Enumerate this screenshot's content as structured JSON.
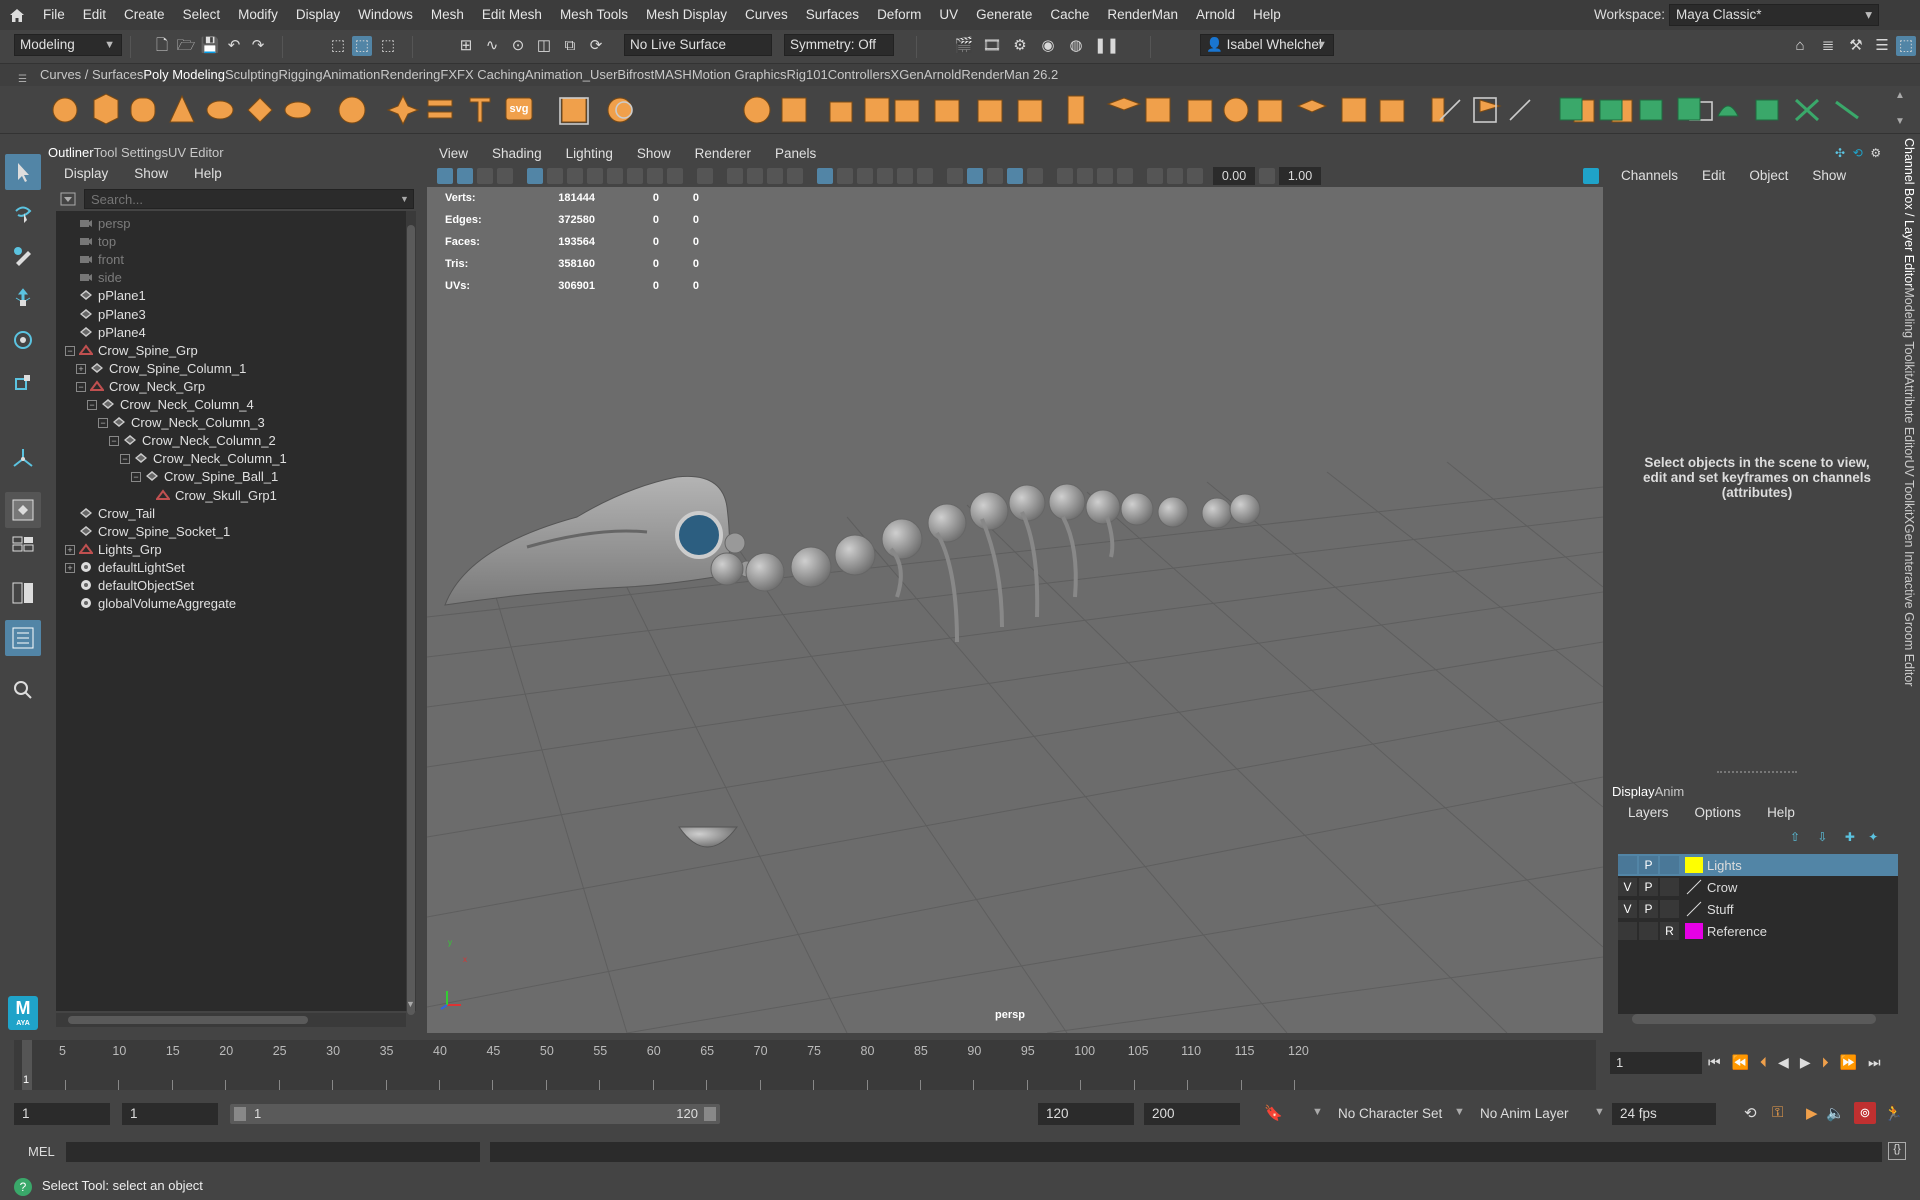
{
  "menubar": {
    "items": [
      "File",
      "Edit",
      "Create",
      "Select",
      "Modify",
      "Display",
      "Windows",
      "Mesh",
      "Edit Mesh",
      "Mesh Tools",
      "Mesh Display",
      "Curves",
      "Surfaces",
      "Deform",
      "UV",
      "Generate",
      "Cache",
      "RenderMan",
      "Arnold",
      "Help"
    ],
    "workspace_label": "Workspace:",
    "workspace_value": "Maya Classic*"
  },
  "statusline": {
    "mode": "Modeling",
    "live_surface": "No Live Surface",
    "symmetry": "Symmetry: Off",
    "user": "Isabel Whelchel"
  },
  "shelf": {
    "tabs": [
      "Curves / Surfaces",
      "Poly Modeling",
      "Sculpting",
      "Rigging",
      "Animation",
      "Rendering",
      "FX",
      "FX Caching",
      "Animation_User",
      "Bifrost",
      "MASH",
      "Motion Graphics",
      "Rig101",
      "Controllers",
      "XGen",
      "Arnold",
      "RenderMan 26.2"
    ],
    "active_tab": "Poly Modeling",
    "svg_label": "svg"
  },
  "outliner": {
    "tabs": [
      "Outliner",
      "Tool Settings",
      "UV Editor"
    ],
    "menu": [
      "Display",
      "Show",
      "Help"
    ],
    "search_placeholder": "Search...",
    "nodes": [
      {
        "label": "persp",
        "type": "camera"
      },
      {
        "label": "top",
        "type": "camera"
      },
      {
        "label": "front",
        "type": "camera"
      },
      {
        "label": "side",
        "type": "camera"
      },
      {
        "label": "pPlane1",
        "type": "mesh"
      },
      {
        "label": "pPlane3",
        "type": "mesh"
      },
      {
        "label": "pPlane4",
        "type": "mesh"
      },
      {
        "label": "Crow_Spine_Grp",
        "type": "group"
      },
      {
        "label": "Crow_Spine_Column_1",
        "type": "mesh"
      },
      {
        "label": "Crow_Neck_Grp",
        "type": "group"
      },
      {
        "label": "Crow_Neck_Column_4",
        "type": "mesh"
      },
      {
        "label": "Crow_Neck_Column_3",
        "type": "mesh"
      },
      {
        "label": "Crow_Neck_Column_2",
        "type": "mesh"
      },
      {
        "label": "Crow_Neck_Column_1",
        "type": "mesh"
      },
      {
        "label": "Crow_Spine_Ball_1",
        "type": "mesh"
      },
      {
        "label": "Crow_Skull_Grp1",
        "type": "group"
      },
      {
        "label": "Crow_Tail",
        "type": "mesh"
      },
      {
        "label": "Crow_Spine_Socket_1",
        "type": "mesh"
      },
      {
        "label": "Lights_Grp",
        "type": "group"
      },
      {
        "label": "defaultLightSet",
        "type": "set"
      },
      {
        "label": "defaultObjectSet",
        "type": "set"
      },
      {
        "label": "globalVolumeAggregate",
        "type": "volume"
      }
    ]
  },
  "viewport": {
    "menu": [
      "View",
      "Shading",
      "Lighting",
      "Show",
      "Renderer",
      "Panels"
    ],
    "field_a": "0.00",
    "field_b": "1.00",
    "hud": [
      {
        "label": "Verts:",
        "a": "181444",
        "b": "0",
        "c": "0"
      },
      {
        "label": "Edges:",
        "a": "372580",
        "b": "0",
        "c": "0"
      },
      {
        "label": "Faces:",
        "a": "193564",
        "b": "0",
        "c": "0"
      },
      {
        "label": "Tris:",
        "a": "358160",
        "b": "0",
        "c": "0"
      },
      {
        "label": "UVs:",
        "a": "306901",
        "b": "0",
        "c": "0"
      }
    ],
    "camera_label": "persp",
    "axis_x": "x",
    "axis_y": "y"
  },
  "channelbox": {
    "menu": [
      "Channels",
      "Edit",
      "Object",
      "Show"
    ],
    "hint": "Select objects in the scene to view, edit and set keyframes on channels (attributes)"
  },
  "side_tabs": {
    "items": [
      "Channel Box / Layer Editor",
      "Modeling Toolkit",
      "Attribute Editor",
      "UV Toolkit",
      "XGen Interactive Groom Editor"
    ]
  },
  "layer_editor": {
    "tabs": [
      "Display",
      "Anim"
    ],
    "menu": [
      "Layers",
      "Options",
      "Help"
    ],
    "layers": [
      {
        "v": "",
        "p": "P",
        "r": "",
        "name": "Lights",
        "color": "#ffff00",
        "selected": true
      },
      {
        "v": "V",
        "p": "P",
        "r": "",
        "name": "Crow",
        "color": "",
        "selected": false
      },
      {
        "v": "V",
        "p": "P",
        "r": "",
        "name": "Stuff",
        "color": "",
        "selected": false
      },
      {
        "v": "",
        "p": "",
        "r": "R",
        "name": "Reference",
        "color": "#e600e6",
        "selected": false
      }
    ]
  },
  "timeslider": {
    "ticks": [
      "5",
      "10",
      "15",
      "20",
      "25",
      "30",
      "35",
      "40",
      "45",
      "50",
      "55",
      "60",
      "65",
      "70",
      "75",
      "80",
      "85",
      "90",
      "95",
      "100",
      "105",
      "110",
      "115",
      "120"
    ],
    "current_marker": "1",
    "current_frame": "1"
  },
  "range": {
    "start": "1",
    "inner_start": "1",
    "slider_start": "1",
    "slider_end": "120",
    "end": "120",
    "outer_end": "200",
    "character_set": "No Character Set",
    "anim_layer": "No Anim Layer",
    "fps": "24 fps"
  },
  "cmdline": {
    "label": "MEL"
  },
  "helpline": {
    "text": "Select Tool: select an object"
  },
  "colors": {
    "accent": "#5285a6",
    "shelf_orange": "#f0a04b",
    "maya_teal": "#1fa3c9"
  }
}
